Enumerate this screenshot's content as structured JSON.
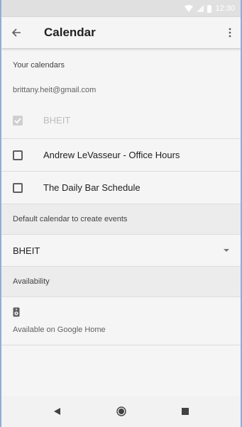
{
  "status_bar": {
    "time": "12:30"
  },
  "app_bar": {
    "title": "Calendar"
  },
  "your_calendars": {
    "header": "Your calendars",
    "account": "brittany.heit@gmail.com",
    "items": [
      {
        "label": "BHEIT",
        "checked": true,
        "disabled": true
      },
      {
        "label": "Andrew LeVasseur - Office Hours",
        "checked": false,
        "disabled": false
      },
      {
        "label": "The Daily Bar Schedule",
        "checked": false,
        "disabled": false
      }
    ]
  },
  "default_calendar": {
    "header": "Default calendar to create events",
    "selected": "BHEIT"
  },
  "availability": {
    "header": "Availability",
    "item_label": "Available on Google Home",
    "icon": "speaker-icon"
  },
  "nav": {
    "back": "back-triangle",
    "home": "home-circle",
    "recents": "recents-square"
  }
}
